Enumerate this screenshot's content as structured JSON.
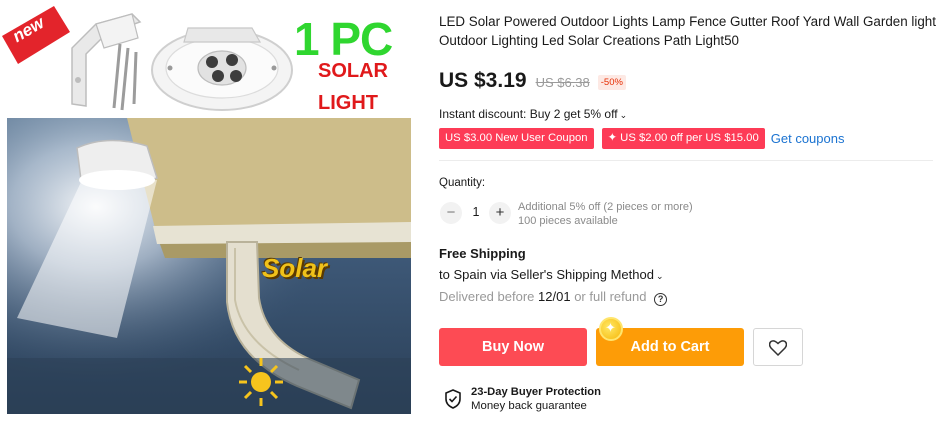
{
  "image": {
    "badge": "new",
    "headline": "1 PC",
    "line1": "SOLAR",
    "line2": "LIGHT",
    "logo_text": "Solar"
  },
  "product": {
    "title": "LED Solar Powered Outdoor Lights Lamp Fence Gutter Roof Yard Wall Garden light Outdoor Lighting Led Solar Creations Path Light50"
  },
  "price": {
    "current": "US $3.19",
    "original": "US $6.38",
    "discount": "-50%"
  },
  "promo": {
    "instant_discount": "Instant discount: Buy 2 get 5% off",
    "coupon_new_user": "US $3.00 New User Coupon",
    "coupon_store": "US $2.00 off per US $15.00",
    "get_coupons": "Get coupons"
  },
  "quantity": {
    "label": "Quantity:",
    "value": "1",
    "minus": "−",
    "plus": "+",
    "additional": "Additional 5% off (2 pieces or more)",
    "available": "100 pieces available"
  },
  "shipping": {
    "title": "Free Shipping",
    "to": "to Spain via Seller's Shipping Method",
    "delivered_prefix": "Delivered before",
    "delivered_date": "12/01",
    "delivered_suffix": "or full refund",
    "help": "?"
  },
  "actions": {
    "buy_now": "Buy Now",
    "add_to_cart": "Add to Cart"
  },
  "protection": {
    "title": "23-Day Buyer Protection",
    "subtitle": "Money back guarantee"
  },
  "colors": {
    "buy_now": "#fd4b54",
    "add_to_cart": "#fd9c07",
    "coupon": "#fd3b56",
    "link": "#1b73d1",
    "discount": "#e62e04"
  },
  "icons": [
    "new-badge-icon",
    "heart-icon",
    "shield-check-icon",
    "help-circle-icon",
    "chevron-down-icon",
    "coin-icon",
    "sun-icon"
  ]
}
